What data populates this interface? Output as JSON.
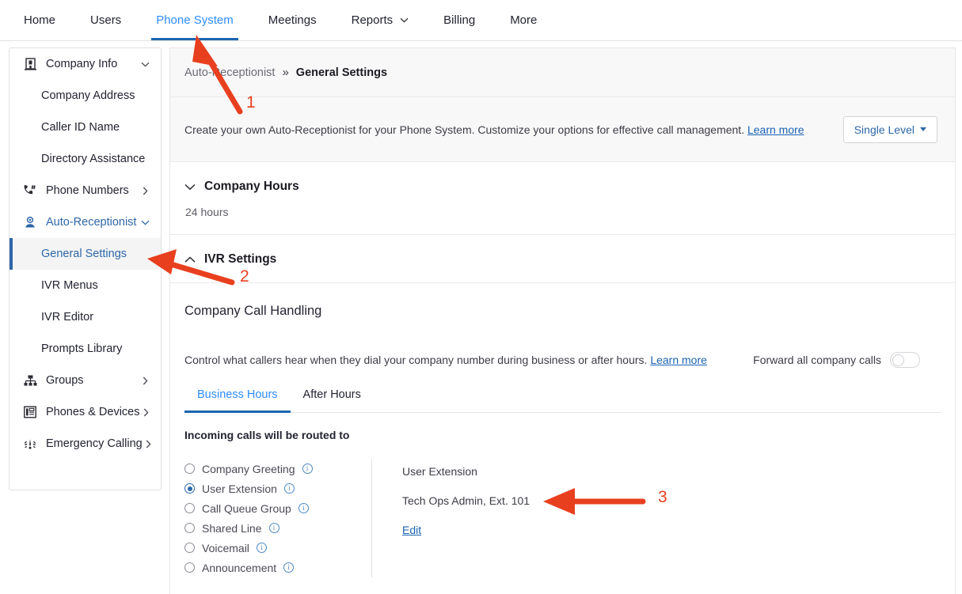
{
  "topnav": {
    "items": [
      {
        "label": "Home",
        "active": false,
        "caret": false
      },
      {
        "label": "Users",
        "active": false,
        "caret": false
      },
      {
        "label": "Phone System",
        "active": true,
        "caret": false
      },
      {
        "label": "Meetings",
        "active": false,
        "caret": false
      },
      {
        "label": "Reports",
        "active": false,
        "caret": true
      },
      {
        "label": "Billing",
        "active": false,
        "caret": false
      },
      {
        "label": "More",
        "active": false,
        "caret": false
      }
    ]
  },
  "sidebar": {
    "items": [
      {
        "label": "Company Info",
        "icon": "building-icon",
        "chevron": "down",
        "child": false,
        "current": false,
        "blue": false
      },
      {
        "label": "Company Address",
        "icon": "",
        "chevron": "",
        "child": true,
        "current": false,
        "blue": false
      },
      {
        "label": "Caller ID Name",
        "icon": "",
        "chevron": "",
        "child": true,
        "current": false,
        "blue": false
      },
      {
        "label": "Directory Assistance",
        "icon": "",
        "chevron": "",
        "child": true,
        "current": false,
        "blue": false
      },
      {
        "label": "Phone Numbers",
        "icon": "phone-hash-icon",
        "chevron": "right",
        "child": false,
        "current": false,
        "blue": false
      },
      {
        "label": "Auto-Receptionist",
        "icon": "receptionist-icon",
        "chevron": "down",
        "child": false,
        "current": false,
        "blue": true
      },
      {
        "label": "General Settings",
        "icon": "",
        "chevron": "",
        "child": true,
        "current": true,
        "blue": false
      },
      {
        "label": "IVR Menus",
        "icon": "",
        "chevron": "",
        "child": true,
        "current": false,
        "blue": false
      },
      {
        "label": "IVR Editor",
        "icon": "",
        "chevron": "",
        "child": true,
        "current": false,
        "blue": false
      },
      {
        "label": "Prompts Library",
        "icon": "",
        "chevron": "",
        "child": true,
        "current": false,
        "blue": false
      },
      {
        "label": "Groups",
        "icon": "org-chart-icon",
        "chevron": "right",
        "child": false,
        "current": false,
        "blue": false
      },
      {
        "label": "Phones & Devices",
        "icon": "desk-phone-icon",
        "chevron": "right",
        "child": false,
        "current": false,
        "blue": false
      },
      {
        "label": "Emergency Calling",
        "icon": "emergency-siren-icon",
        "chevron": "right",
        "child": false,
        "current": false,
        "blue": false
      }
    ]
  },
  "breadcrumb": {
    "parent": "Auto-Receptionist",
    "separator": "»",
    "current": "General Settings"
  },
  "description": {
    "text": "Create your own Auto-Receptionist for your Phone System. Customize your options for effective call management.",
    "learn_more": "Learn more",
    "level_button": "Single Level"
  },
  "company_hours": {
    "title": "Company Hours",
    "value": "24 hours",
    "chevron": "down"
  },
  "ivr_settings": {
    "title": "IVR Settings",
    "chevron": "up"
  },
  "call_handling": {
    "title": "Company Call Handling",
    "description": "Control what callers hear when they dial your company number during business or after hours.",
    "learn_more": "Learn more",
    "forward_label": "Forward all company calls",
    "forward_on": false,
    "tabs": [
      {
        "label": "Business Hours",
        "active": true
      },
      {
        "label": "After Hours",
        "active": false
      }
    ],
    "routed_heading": "Incoming calls will be routed to",
    "options": [
      {
        "label": "Company Greeting",
        "selected": false
      },
      {
        "label": "User Extension",
        "selected": true
      },
      {
        "label": "Call Queue Group",
        "selected": false
      },
      {
        "label": "Shared Line",
        "selected": false
      },
      {
        "label": "Voicemail",
        "selected": false
      },
      {
        "label": "Announcement",
        "selected": false
      }
    ],
    "detail": {
      "heading": "User Extension",
      "value": "Tech Ops Admin, Ext. 101",
      "edit_label": "Edit"
    }
  },
  "annotations": {
    "color": "#e8401f",
    "markers": [
      {
        "number": "1"
      },
      {
        "number": "2"
      },
      {
        "number": "3"
      }
    ]
  }
}
